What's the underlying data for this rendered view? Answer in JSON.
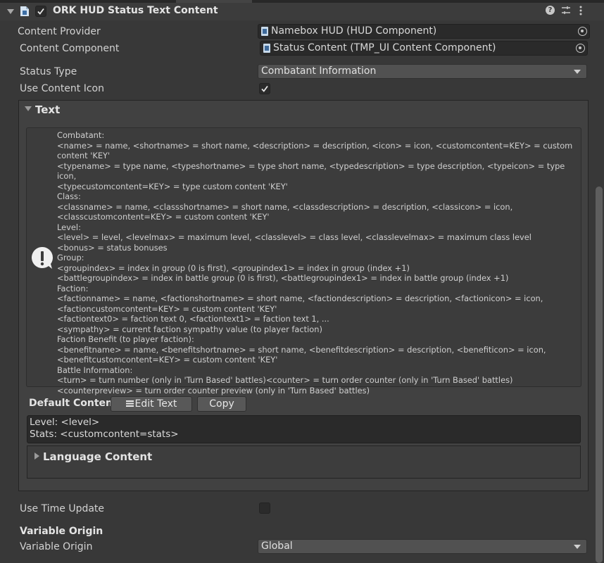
{
  "component": {
    "title": "ORK HUD Status Text Content",
    "enabled": true
  },
  "header_icons": [
    "help-icon",
    "preset-icon",
    "more-options-icon"
  ],
  "fields": {
    "content_provider": {
      "label": "Content Provider",
      "value": "Namebox HUD (HUD Component)"
    },
    "content_component": {
      "label": "Content Component",
      "value": "Status Content (TMP_UI Content Component)"
    },
    "status_type": {
      "label": "Status Type",
      "value": "Combatant Information"
    },
    "use_content_icon": {
      "label": "Use Content Icon",
      "checked": true
    }
  },
  "text_section": {
    "title": "Text",
    "help_lines": [
      "Combatant:",
      "<name> = name, <shortname> = short name, <description> = description, <icon> = icon, <customcontent=KEY> = custom",
      "content 'KEY'",
      "<typename> = type name, <typeshortname> = type short name, <typedescription> = type description, <typeicon> = type icon,",
      "<typecustomcontent=KEY> = type custom content 'KEY'",
      "Class:",
      "<classname> = name, <classshortname> = short name, <classdescription> = description, <classicon> = icon,",
      "<classcustomcontent=KEY> = custom content 'KEY'",
      "Level:",
      "<level> = level, <levelmax> = maximum level, <classlevel> = class level, <classlevelmax> = maximum class level",
      "<bonus> = status bonuses",
      "Group:",
      "<groupindex> = index in group (0 is first), <groupindex1> = index in group (index +1)",
      "<battlegroupindex> = index in battle group (0 is first), <battlegroupindex1> = index in battle group (index +1)",
      "Faction:",
      "<factionname> = name, <factionshortname> = short name, <factiondescription> = description, <factionicon> = icon,",
      "<factioncustomcontent=KEY> = custom content 'KEY'",
      "<factiontext0> = faction text 0, <factiontext1> = faction text 1, ...",
      "<sympathy> = current faction sympathy value (to player faction)",
      "Faction Benefit (to player faction):",
      "<benefitname> = name, <benefitshortname> = short name, <benefitdescription> = description, <benefiticon> = icon,",
      "<benefitcustomcontent=KEY> = custom content 'KEY'",
      "Battle Information:",
      "<turn> = turn number (only in 'Turn Based' battles)<counter> = turn order counter (only in 'Turn Based' battles)",
      "<counterpreview> = turn order counter preview (only in 'Turn Based' battles)"
    ],
    "default_content_label": "Default Content",
    "edit_text_button": "Edit Text",
    "copy_button": "Copy",
    "default_content_lines": [
      "Level: <level>",
      "Stats: <customcontent=stats>"
    ],
    "language_content_title": "Language Content"
  },
  "use_time_update": {
    "label": "Use Time Update",
    "checked": false
  },
  "variable_origin": {
    "section_title": "Variable Origin",
    "label": "Variable Origin",
    "value": "Global"
  }
}
